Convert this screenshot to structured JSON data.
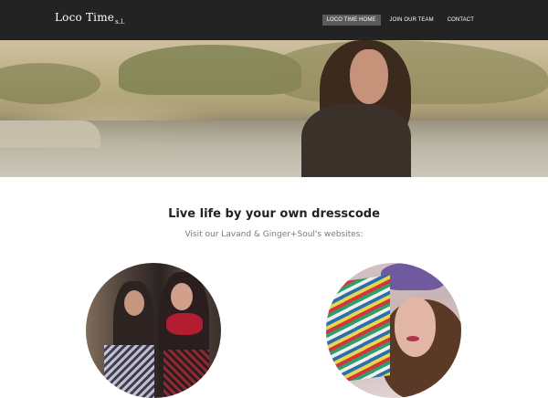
{
  "header": {
    "logo_text": "Loco Time",
    "logo_sup": "s.l.",
    "nav": [
      {
        "label": "LOCO TIME HOME",
        "active": true
      },
      {
        "label": "JOIN OUR TEAM",
        "active": false
      },
      {
        "label": "CONTACT",
        "active": false
      }
    ]
  },
  "content": {
    "tagline": "Live life by your own dresscode",
    "subtitle": "Visit our Lavand & Ginger+Soul's websites:"
  },
  "colors": {
    "header_bg": "#232323",
    "active_nav_bg": "#5a5a5a",
    "text_dark": "#222222",
    "text_muted": "#7a7a7a"
  }
}
